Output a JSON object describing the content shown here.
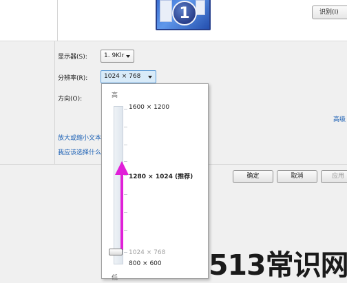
{
  "preview": {
    "monitor_number": "1",
    "identify_button": "识别(I)"
  },
  "settings": {
    "display_label": "显示器(S):",
    "display_value": "1. 9Klr",
    "resolution_label": "分辨率(R):",
    "resolution_value": "1024 × 768",
    "orientation_label": "方向(O):",
    "advanced_link": "高级"
  },
  "links": {
    "text_size": "放大或缩小文本",
    "which_settings": "我应该选择什么"
  },
  "buttons": {
    "ok": "确定",
    "cancel": "取消",
    "apply": "应用"
  },
  "resolution_dropdown": {
    "high_label": "高",
    "low_label": "低",
    "options": [
      {
        "label": "1600 × 1200"
      },
      {
        "label": "1280 × 1024 (推荐)"
      },
      {
        "label": "1024 × 768"
      },
      {
        "label": "800 × 600"
      }
    ],
    "selected": "1024 × 768",
    "arrow_color": "#e020d8"
  },
  "watermark": "513常识网"
}
